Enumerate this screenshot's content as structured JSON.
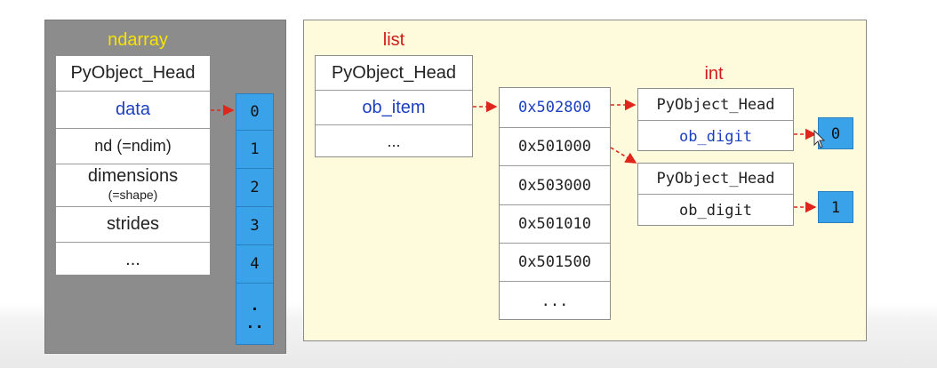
{
  "ndarray": {
    "title": "ndarray",
    "fields": [
      "PyObject_Head",
      "data",
      "nd (=ndim)",
      "dimensions",
      "(=shape)",
      "strides",
      "..."
    ],
    "cells": [
      "0",
      "1",
      "2",
      "3",
      "4",
      ".",
      ".."
    ]
  },
  "list": {
    "title": "list",
    "fields": [
      "PyObject_Head",
      "ob_item",
      "..."
    ],
    "addresses": [
      "0x502800",
      "0x501000",
      "0x503000",
      "0x501010",
      "0x501500",
      "..."
    ]
  },
  "int": {
    "title": "int",
    "objects": [
      {
        "head": "PyObject_Head",
        "digit": "ob_digit",
        "value": "0"
      },
      {
        "head": "PyObject_Head",
        "digit": "ob_digit",
        "value": "1"
      }
    ]
  },
  "colors": {
    "title_yellow": "#f5e400",
    "title_red": "#d21a1a",
    "pointer_blue": "#1b3fbf",
    "cell_blue": "#3aa2e8",
    "arrow_red": "#e0261c"
  }
}
